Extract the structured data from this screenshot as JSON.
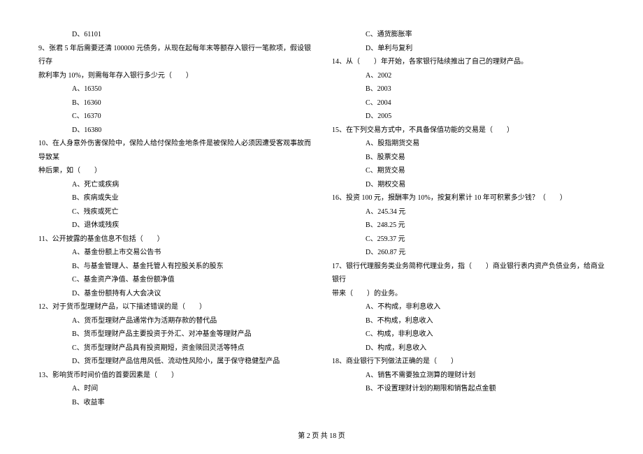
{
  "left_column": [
    {
      "type": "option",
      "text": "D、61101"
    },
    {
      "type": "question",
      "text": "9、张君 5 年后需要还清 100000 元债务，从现在起每年末等额存入银行一笔款项，假设银行存"
    },
    {
      "type": "question-cont",
      "text": "款利率为 10%，则需每年存入银行多少元（　　）"
    },
    {
      "type": "option",
      "text": "A、16350"
    },
    {
      "type": "option",
      "text": "B、16360"
    },
    {
      "type": "option",
      "text": "C、16370"
    },
    {
      "type": "option",
      "text": "D、16380"
    },
    {
      "type": "question",
      "text": "10、在人身意外伤害保险中，保险人给付保险金地条件是被保险人必须因遭受客观事故而导致某"
    },
    {
      "type": "question-cont",
      "text": "种后果，如（　　）"
    },
    {
      "type": "option",
      "text": "A、死亡或疾病"
    },
    {
      "type": "option",
      "text": "B、疾病或失业"
    },
    {
      "type": "option",
      "text": "C、残疾或死亡"
    },
    {
      "type": "option",
      "text": "D、退休或残疾"
    },
    {
      "type": "question",
      "text": "11、公开披露的基金信息不包括（　　）"
    },
    {
      "type": "option",
      "text": "A、基金份额上市交易公告书"
    },
    {
      "type": "option",
      "text": "B、与基金管理人、基金托管人有控股关系的股东"
    },
    {
      "type": "option",
      "text": "C、基金资产净值、基金份额净值"
    },
    {
      "type": "option",
      "text": "D、基金份额持有人大会决议"
    },
    {
      "type": "question",
      "text": "12、对于货币型理财产品，以下描述错误的是（　　）"
    },
    {
      "type": "option",
      "text": "A、货币型理财产品通常作为活期存款的替代品"
    },
    {
      "type": "option",
      "text": "B、货币型理财产品主要投资于外汇、对冲基金等理财产品"
    },
    {
      "type": "option",
      "text": "C、货币型理财产品具有投资期短，资金赎回灵活等特点"
    },
    {
      "type": "option",
      "text": "D、货币型理财产品信用风低、流动性风险小，属于保守稳健型产品"
    },
    {
      "type": "question",
      "text": "13、影响货币时间价值的首要因素是（　　）"
    },
    {
      "type": "option",
      "text": "A、时间"
    },
    {
      "type": "option",
      "text": "B、收益率"
    }
  ],
  "right_column": [
    {
      "type": "option",
      "text": "C、通货膨胀率"
    },
    {
      "type": "option",
      "text": "D、单利与复利"
    },
    {
      "type": "question",
      "text": "14、从（　　）年开始，各家银行陆续推出了自己的理财产品。"
    },
    {
      "type": "option",
      "text": "A、2002"
    },
    {
      "type": "option",
      "text": "B、2003"
    },
    {
      "type": "option",
      "text": "C、2004"
    },
    {
      "type": "option",
      "text": "D、2005"
    },
    {
      "type": "question",
      "text": "15、在下列交易方式中，不具备保值功能的交易是（　　）"
    },
    {
      "type": "option",
      "text": "A、股指期货交易"
    },
    {
      "type": "option",
      "text": "B、股票交易"
    },
    {
      "type": "option",
      "text": "C、期货交易"
    },
    {
      "type": "option",
      "text": "D、期权交易"
    },
    {
      "type": "question",
      "text": "16、投资 100 元，报酬率为 10%，按复利累计 10 年可积累多少钱？（　　）"
    },
    {
      "type": "option",
      "text": "A、245.34 元"
    },
    {
      "type": "option",
      "text": "B、248.25 元"
    },
    {
      "type": "option",
      "text": "C、259.37 元"
    },
    {
      "type": "option",
      "text": "D、260.87 元"
    },
    {
      "type": "question",
      "text": "17、银行代理服务类业务简称代理业务，指（　　）商业银行表内资产负债业务，给商业银行"
    },
    {
      "type": "question-cont",
      "text": "带来（　　）的业务。"
    },
    {
      "type": "option",
      "text": "A、不构成，非利息收入"
    },
    {
      "type": "option",
      "text": "B、不构成，利息收入"
    },
    {
      "type": "option",
      "text": "C、构成，非利息收入"
    },
    {
      "type": "option",
      "text": "D、构成，利息收入"
    },
    {
      "type": "question",
      "text": "18、商业银行下列做法正确的是（　　）"
    },
    {
      "type": "option",
      "text": "A、销售不需要独立测算的理财计划"
    },
    {
      "type": "option",
      "text": "B、不设置理财计划的期限和销售起点金额"
    }
  ],
  "footer": {
    "page_text": "第 2 页 共 18 页"
  }
}
